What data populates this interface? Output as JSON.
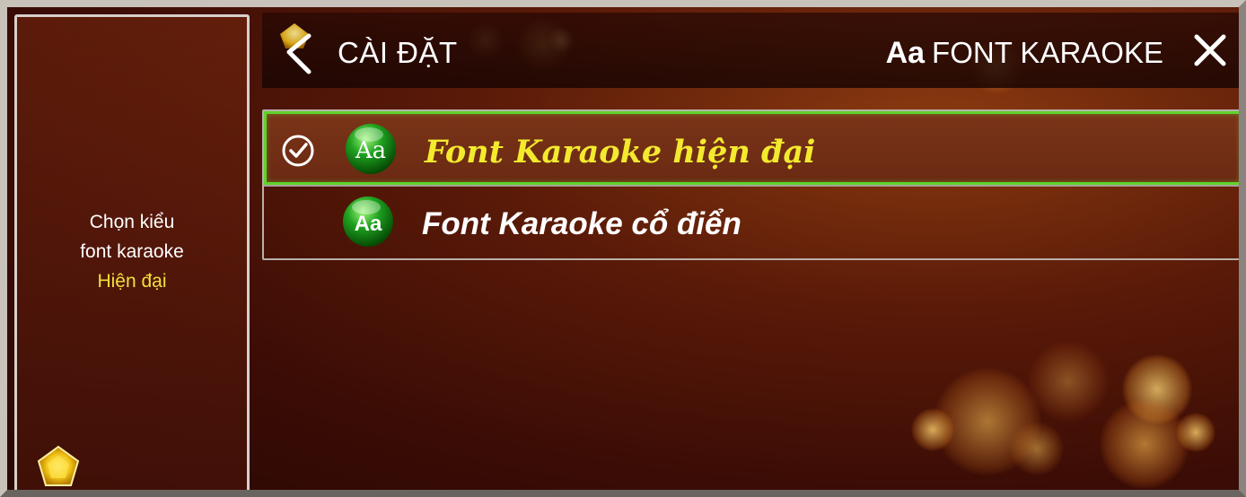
{
  "sidebar": {
    "line1": "Chọn kiểu",
    "line2": "font karaoke",
    "value": "Hiện đại"
  },
  "header": {
    "title": "CÀI ĐẶT",
    "right_icon_text": "Aa",
    "right_title": "FONT KARAOKE",
    "back_icon": "chevron-left-icon",
    "close_icon": "close-icon"
  },
  "options": [
    {
      "label": "Font Karaoke hiện đại",
      "icon_text": "Aa",
      "selected": true
    },
    {
      "label": "Font Karaoke cổ điển",
      "icon_text": "Aa",
      "selected": false
    }
  ],
  "colors": {
    "accent_yellow": "#f3ea2e",
    "selection_border": "#5fd42a",
    "icon_green": "#1fa21f"
  }
}
